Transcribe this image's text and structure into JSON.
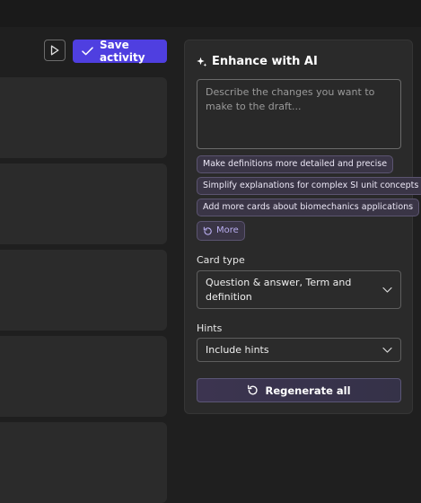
{
  "toolbar": {
    "play_icon": "play-icon",
    "save_label": "Save activity",
    "save_icon": "checkmark-icon",
    "accent_color": "#4f3fe0"
  },
  "panel": {
    "title": "Enhance with AI",
    "title_icon": "sparkle-icon",
    "prompt_placeholder": "Describe the changes you want to make to the draft...",
    "suggestions": [
      "Make definitions more detailed and precise",
      "Simplify explanations for complex SI unit concepts",
      "Add more cards about biomechanics applications"
    ],
    "more_label": "More",
    "more_icon": "refresh-icon",
    "card_type": {
      "label": "Card type",
      "value": "Question & answer, Term and definition"
    },
    "hints": {
      "label": "Hints",
      "value": "Include hints"
    },
    "regenerate_label": "Regenerate all",
    "regenerate_icon": "refresh-icon"
  }
}
